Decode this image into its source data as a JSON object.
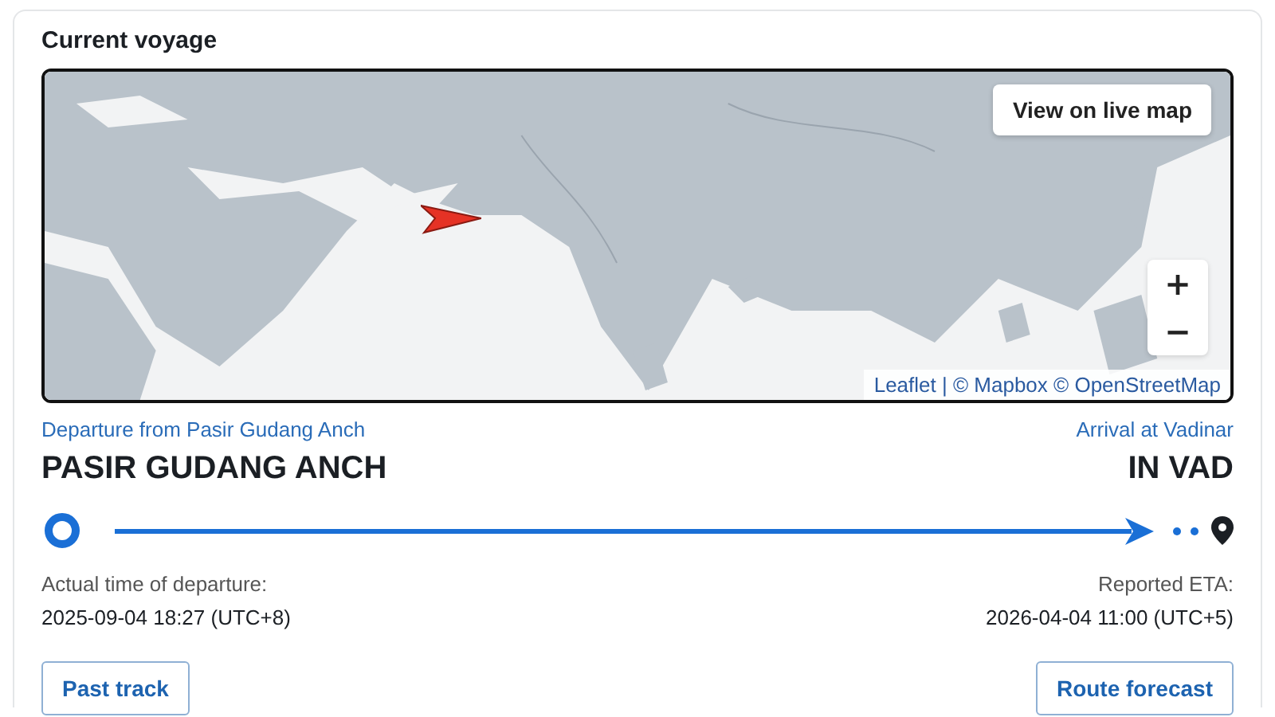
{
  "card": {
    "title": "Current voyage"
  },
  "map": {
    "live_map_button": "View on live map",
    "zoom_in": "+",
    "zoom_out": "−",
    "attribution": "Leaflet | © Mapbox © OpenStreetMap"
  },
  "departure": {
    "caption": "Departure from Pasir Gudang Anch",
    "port": "PASIR GUDANG ANCH",
    "time_label": "Actual time of departure:",
    "time": "2025-09-04 18:27 (UTC+8)"
  },
  "arrival": {
    "caption": "Arrival at Vadinar",
    "port": "IN VAD",
    "time_label": "Reported ETA:",
    "time": "2026-04-04 11:00 (UTC+5)"
  },
  "buttons": [
    "Past track",
    "Route forecast"
  ]
}
